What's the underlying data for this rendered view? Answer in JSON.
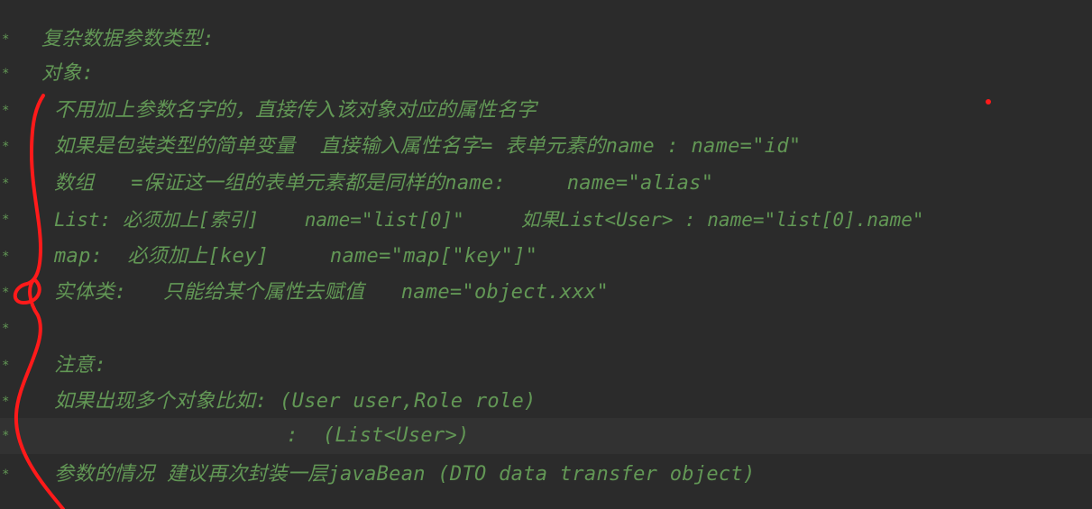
{
  "editor": {
    "comment_lines": [
      {
        "prefix": "*",
        "text": "复杂数据参数类型:"
      },
      {
        "prefix": "*",
        "text": "对象:"
      },
      {
        "prefix": "*",
        "text": "不用加上参数名字的，直接传入该对象对应的属性名字"
      },
      {
        "prefix": "*",
        "text": "如果是包装类型的简单变量  直接输入属性名字= 表单元素的name : name=\"id\""
      },
      {
        "prefix": "*",
        "text": "数组   =保证这一组的表单元素都是同样的name:     name=\"alias\""
      },
      {
        "prefix": "*",
        "text": "List: 必须加上[索引]    name=\"list[0]\"     如果List<User> : name=\"list[0].name\""
      },
      {
        "prefix": "*",
        "text": "map:  必须加上[key]     name=\"map[\"key\"]\""
      },
      {
        "prefix": "*",
        "text": "实体类:   只能给某个属性去赋值   name=\"object.xxx\""
      },
      {
        "prefix": "*",
        "text": ""
      },
      {
        "prefix": "*",
        "text": "注意:"
      },
      {
        "prefix": "*",
        "text": "如果出现多个对象比如: (User user,Role role)"
      },
      {
        "prefix": "*",
        "text": "                   :  (List<User>)"
      },
      {
        "prefix": "*",
        "text": "参数的情况 建议再次封装一层javaBean (DTO data transfer object)"
      }
    ],
    "colors": {
      "background": "#2b2b2b",
      "comment_text": "#629755",
      "current_line": "#323232",
      "annotation_red": "#ff0000"
    }
  }
}
